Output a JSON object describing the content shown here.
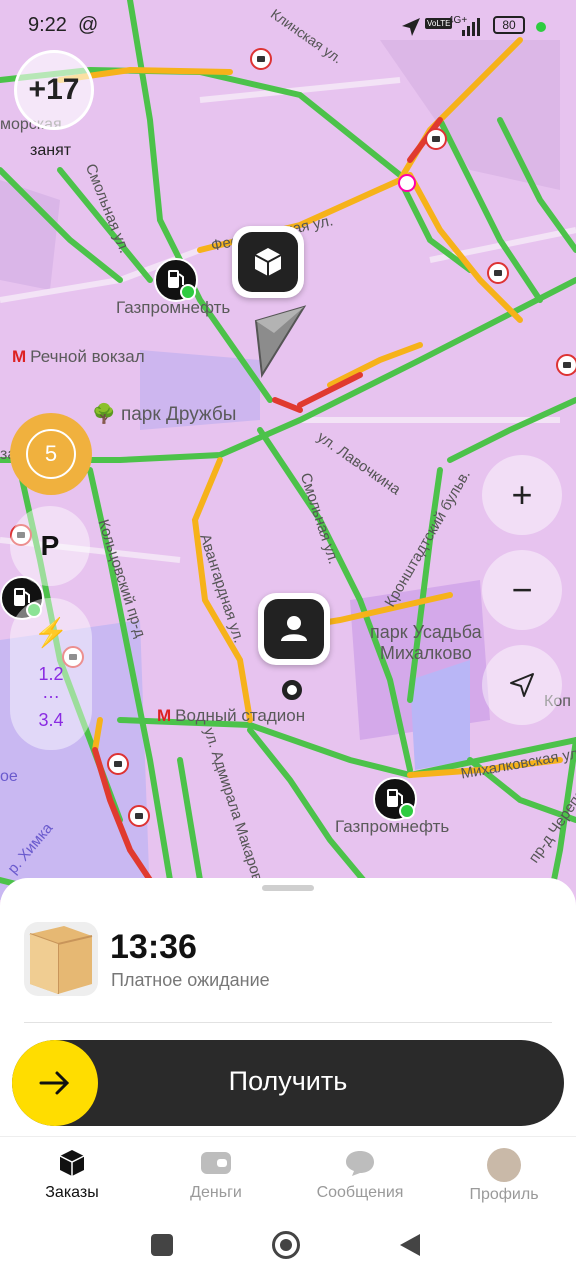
{
  "status_bar": {
    "time": "9:22",
    "at_symbol": "@",
    "network": "4G+",
    "volte": "VoLTE",
    "battery": "80"
  },
  "map": {
    "street_labels": {
      "klinskaya": "Клинская ул.",
      "smolnaya_top": "Смольная ул.",
      "festivalnaya": "Фестивальная ул.",
      "lavochkina": "ул. Лавочкина",
      "smolnaya_mid": "Смольная ул.",
      "avangardnaya": "Авангардная ул.",
      "kronshtadtskiy": "Кронштадтский бульв.",
      "kolontsovskiy": "Кольцовский пр-д",
      "admirala_makarova": "ул. Адмирала Макарова",
      "mikhalkovskaya": "Михалковская ул.",
      "cherepanovykh": "пр-д Черепановых",
      "khimki": "р. Химка"
    },
    "poi": {
      "gas_station_1": "Газпромнефть",
      "gas_station_2": "Газпромнефть",
      "metro_rechnoy": "Речной вокзал",
      "park_druzhby": "парк Дружбы",
      "park_mikhalkovo_line1": "парк Усадьба",
      "park_mikhalkovo_line2": "Михалково",
      "metro_vodny": "Водный стадион",
      "left_edge_text": "морская",
      "left_edge_lake": "ое",
      "left_edge_za": "за",
      "right_edge_kop": "Коп"
    },
    "surge": {
      "value": "+17",
      "label": "занят"
    },
    "timer_badge": "5",
    "parking_label": "P",
    "charging": {
      "line1": "1.2",
      "dots": "…",
      "line2": "3.4"
    },
    "controls": {
      "zoom_in": "+",
      "zoom_out": "−"
    }
  },
  "order": {
    "time": "13:36",
    "subtitle": "Платное ожидание",
    "action_label": "Получить"
  },
  "bottom_nav": [
    {
      "label": "Заказы",
      "active": true
    },
    {
      "label": "Деньги",
      "active": false
    },
    {
      "label": "Сообщения",
      "active": false
    },
    {
      "label": "Профиль",
      "active": false
    }
  ],
  "colors": {
    "accent_yellow": "#ffdd00",
    "dark_button": "#2a2a2a",
    "traffic_green": "#4cc24a",
    "traffic_yellow": "#f6b21a",
    "traffic_red": "#e03a2f"
  }
}
